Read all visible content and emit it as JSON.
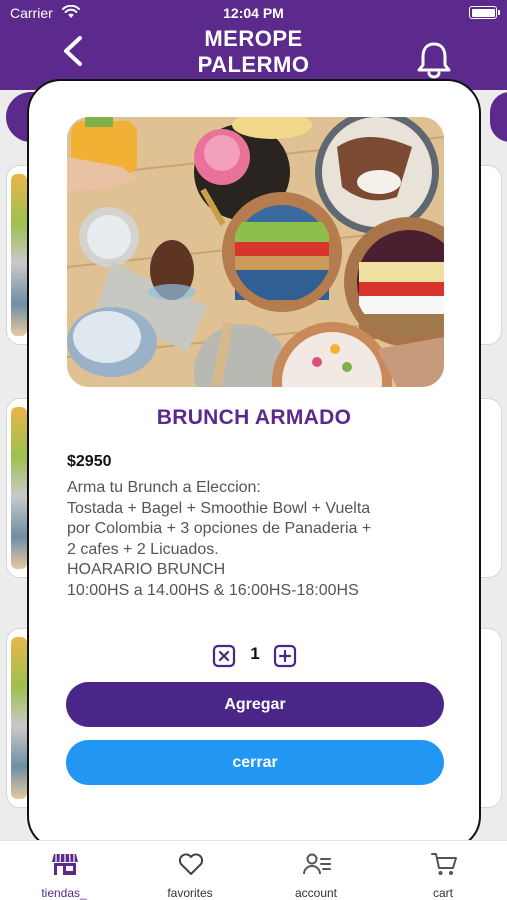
{
  "status_bar": {
    "carrier": "Carrier",
    "time": "12:04 PM"
  },
  "header": {
    "title_line1": "MEROPE",
    "title_line2": "PALERMO"
  },
  "modal": {
    "product_name": "BRUNCH ARMADO",
    "price": "$2950",
    "description_lines": [
      "Arma tu Brunch a Eleccion:",
      "Tostada + Bagel + Smoothie Bowl + Vuelta",
      "por Colombia + 3 opciones de Panaderia +",
      "2 cafes + 2 Licuados.",
      "HOARARIO BRUNCH",
      "10:00HS a 14.00HS & 16:00HS-18:00HS"
    ],
    "quantity": "1",
    "add_label": "Agregar",
    "close_label": "cerrar"
  },
  "tabs": [
    {
      "label": "tiendas_",
      "icon": "store-icon",
      "active": true
    },
    {
      "label": "favorites",
      "icon": "heart-icon",
      "active": false
    },
    {
      "label": "account",
      "icon": "account-icon",
      "active": false
    },
    {
      "label": "cart",
      "icon": "cart-icon",
      "active": false
    }
  ],
  "colors": {
    "brand": "#5b2a8c",
    "primary_button": "#4a2688",
    "secondary_button": "#2196f3"
  }
}
